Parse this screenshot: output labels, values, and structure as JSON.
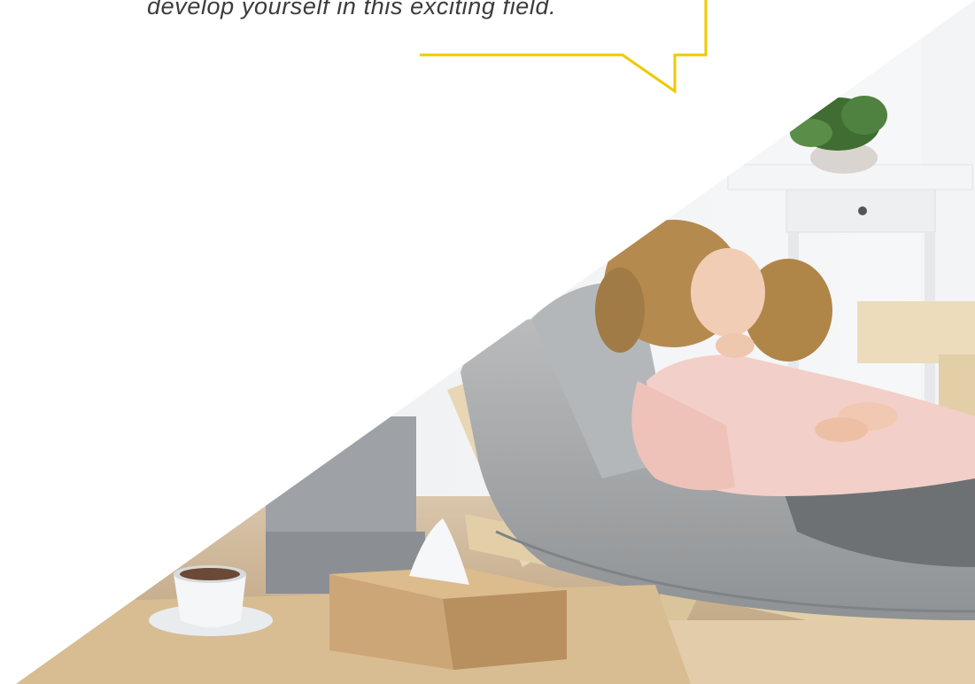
{
  "quote": {
    "text": "develop yourself in this exciting field."
  },
  "colors": {
    "accent": "#f0c800",
    "background": "#ffffff",
    "text": "#3c3c3c"
  }
}
